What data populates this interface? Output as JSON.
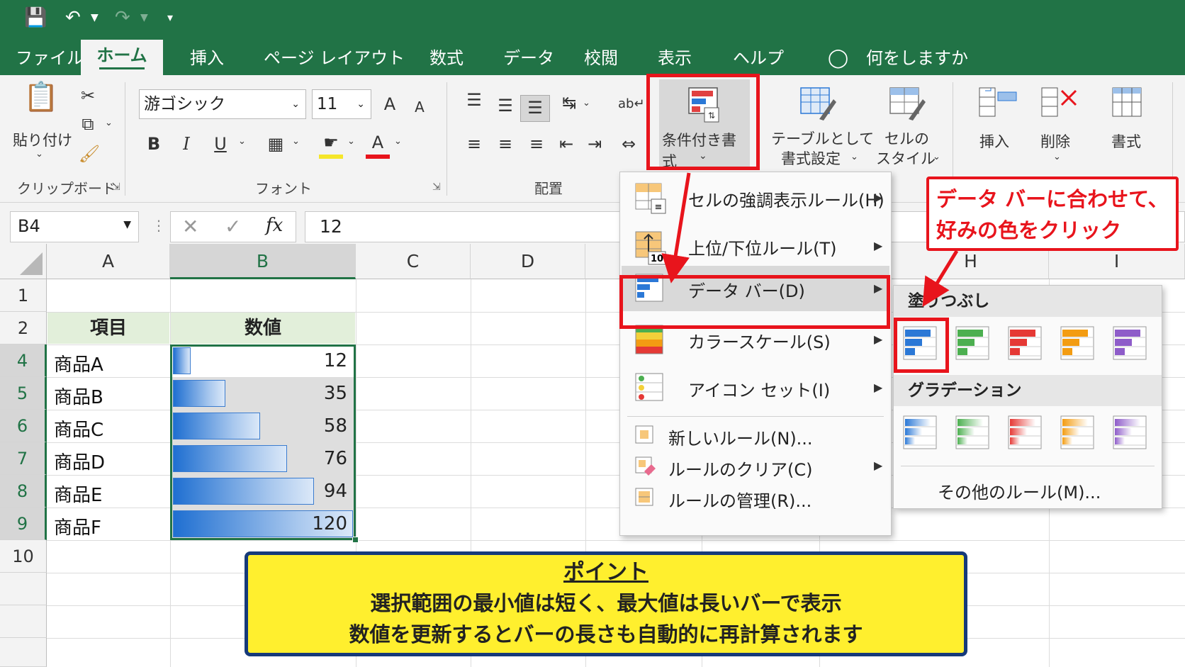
{
  "tabs": [
    "ファイル",
    "ホーム",
    "挿入",
    "ページ レイアウト",
    "数式",
    "データ",
    "校閲",
    "表示",
    "ヘルプ"
  ],
  "tell_me": "何をしますか",
  "ribbon": {
    "paste": "貼り付け",
    "clipboard": "クリップボード",
    "font_name": "游ゴシック",
    "font_size": "11",
    "font_group": "フォント",
    "bold": "B",
    "italic": "I",
    "underline": "U",
    "font_color_letter": "A",
    "grow_font": "A",
    "shrink_font": "A",
    "align_group": "配置",
    "cond_format": "条件付き書式",
    "table_format": [
      "テーブルとして",
      "書式設定"
    ],
    "cell_style": [
      "セルの",
      "スタイル"
    ],
    "insert": "挿入",
    "delete": "削除",
    "format": "書式"
  },
  "formula_bar": {
    "name_box": "B4",
    "fx": "fx",
    "value": "12"
  },
  "columns": [
    "A",
    "B",
    "C",
    "D",
    "H",
    "I"
  ],
  "rows": [
    "1",
    "2",
    "4",
    "5",
    "6",
    "7",
    "8",
    "9",
    "10"
  ],
  "table": {
    "header_item": "項目",
    "header_value": "数値",
    "items": [
      "商品A",
      "商品B",
      "商品C",
      "商品D",
      "商品E",
      "商品F"
    ],
    "values": [
      12,
      35,
      58,
      76,
      94,
      120
    ],
    "value_labels": [
      "12",
      "35",
      "58",
      "76",
      "94",
      "120"
    ]
  },
  "cf_menu": {
    "highlight": "セルの強調表示ルール(H)",
    "topbottom": "上位/下位ルール(T)",
    "topbottom_icon_num": "10",
    "databar": "データ バー(D)",
    "colorscale": "カラースケール(S)",
    "iconset": "アイコン セット(I)",
    "newrule": "新しいルール(N)...",
    "clear": "ルールのクリア(C)",
    "manage": "ルールの管理(R)..."
  },
  "databar_menu": {
    "solid": "塗りつぶし",
    "gradient": "グラデーション",
    "more": "その他のルール(M)...",
    "colors": [
      "#2b78d6",
      "#4caf50",
      "#e53935",
      "#f39c12",
      "#8e5cc9"
    ]
  },
  "callout": [
    "データ バーに合わせて、",
    "好みの色をクリック"
  ],
  "point": {
    "title": "ポイント",
    "line1": "選択範囲の最小値は短く、最大値は長いバーで表示",
    "line2": "数値を更新するとバーの長さも自動的に再計算されます"
  }
}
